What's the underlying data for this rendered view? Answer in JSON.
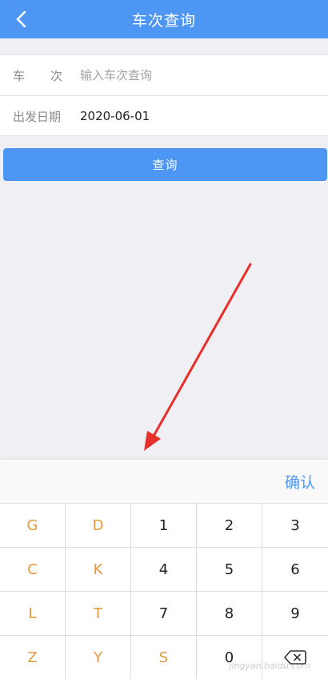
{
  "navbar": {
    "title": "车次查询",
    "back_icon": "chevron-left-icon"
  },
  "form": {
    "train_label": [
      "车",
      "次"
    ],
    "train_placeholder": "输入车次查询",
    "date_label": "出发日期",
    "date_value": "2020-06-01"
  },
  "query_button": "查询",
  "keyboard": {
    "confirm_label": "确认",
    "keys": [
      "G",
      "D",
      "1",
      "2",
      "3",
      "C",
      "K",
      "4",
      "5",
      "6",
      "L",
      "T",
      "7",
      "8",
      "9",
      "Z",
      "Y",
      "S",
      "0",
      ""
    ],
    "delete_icon": "backspace-icon"
  },
  "watermark": "jingyan.baidu.com",
  "colors": {
    "primary": "#4e96f4",
    "letter_key": "#e79a3d",
    "arrow": "#e8302b"
  }
}
